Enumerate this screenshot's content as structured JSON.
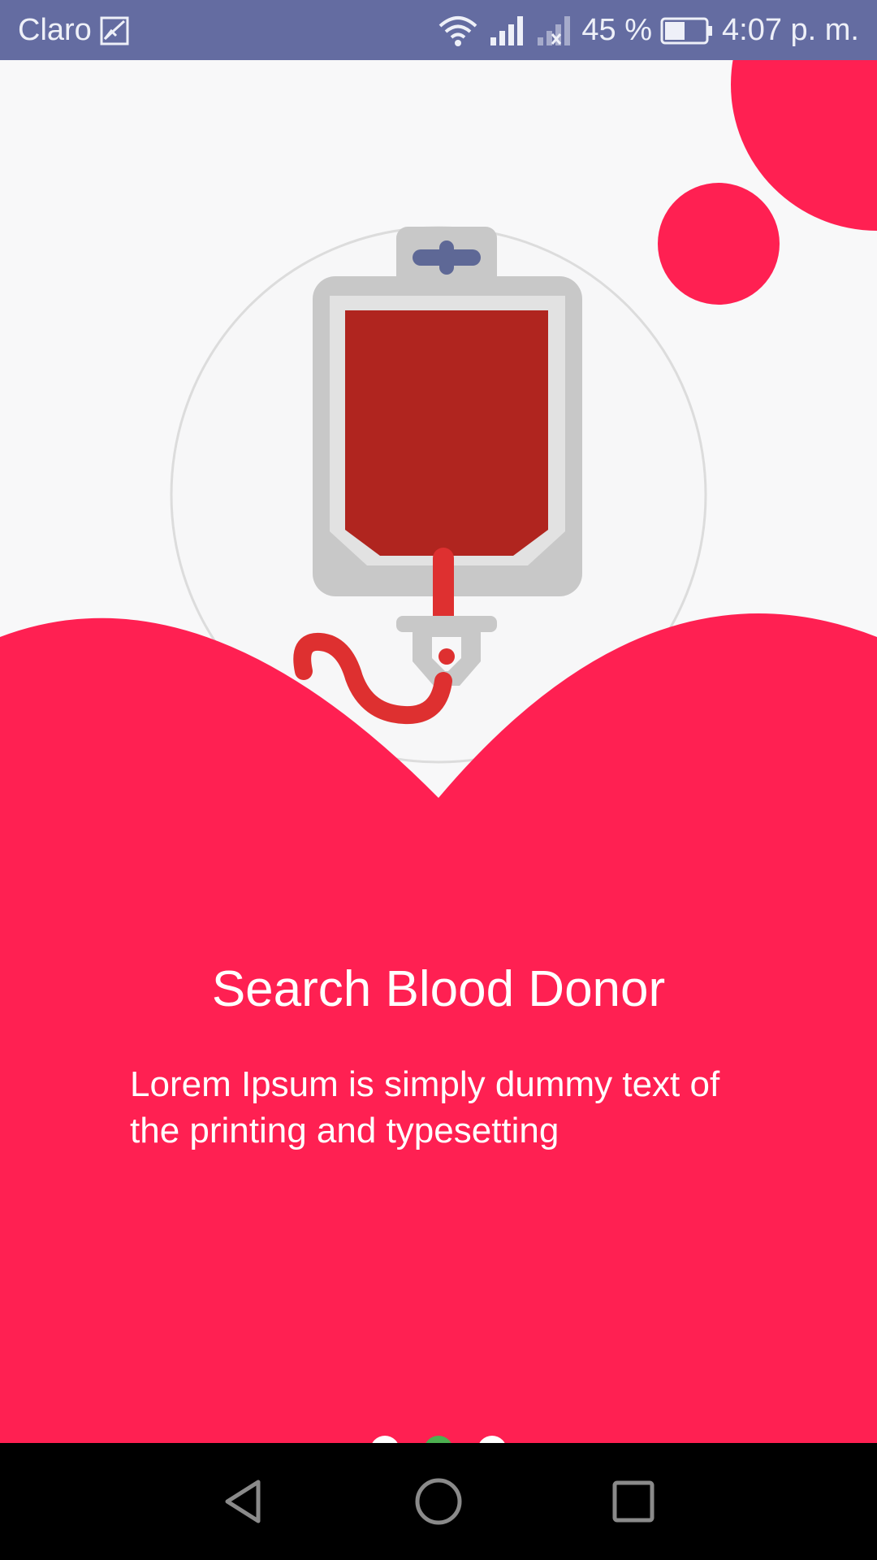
{
  "status_bar": {
    "carrier": "Claro",
    "battery": "45 %",
    "time": "4:07 p. m.",
    "icons": [
      "image-notification-icon",
      "wifi-icon",
      "signal-icon",
      "no-signal-icon",
      "battery-icon"
    ]
  },
  "onboarding": {
    "title": "Search Blood Donor",
    "description": "Lorem Ipsum is simply dummy text of the printing and typesetting",
    "illustration": "blood-bag-icon",
    "page_indicator": {
      "total": 3,
      "active": 2
    }
  },
  "nav_bar": {
    "icons": [
      "back-icon",
      "home-icon",
      "recents-icon"
    ]
  },
  "colors": {
    "status_bar": "#646ca1",
    "accent": "#ff2052",
    "background": "#f8f8f9",
    "indicator_active": "#4caf50",
    "indicator_inactive": "#ffffff",
    "blood": "#b0251f"
  }
}
